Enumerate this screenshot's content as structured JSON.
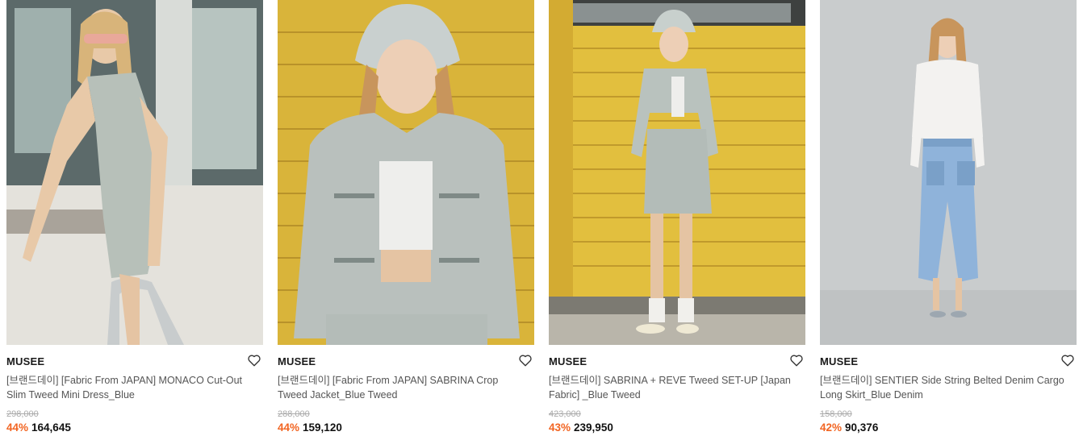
{
  "products": [
    {
      "brand": "MUSEE",
      "name": "[브랜드데이] [Fabric From JAPAN] MONACO Cut-Out Slim Tweed Mini Dress_Blue",
      "original_price": "298,000",
      "discount": "44%",
      "price": "164,645",
      "image": "model-in-tweed-mini-dress-by-pool"
    },
    {
      "brand": "MUSEE",
      "name": "[브랜드데이] [Fabric From JAPAN] SABRINA Crop Tweed Jacket_Blue Tweed",
      "original_price": "288,000",
      "discount": "44%",
      "price": "159,120",
      "image": "model-in-tweed-jacket-and-bucket-hat"
    },
    {
      "brand": "MUSEE",
      "name": "[브랜드데이] SABRINA + REVE Tweed SET-UP [Japan Fabric] _Blue Tweed",
      "original_price": "423,000",
      "discount": "43%",
      "price": "239,950",
      "image": "model-in-tweed-setup-yellow-wall"
    },
    {
      "brand": "MUSEE",
      "name": "[브랜드데이] SENTIER Side String Belted Denim Cargo Long Skirt_Blue Denim",
      "original_price": "158,000",
      "discount": "42%",
      "price": "90,376",
      "image": "model-in-denim-cargo-skirt"
    }
  ],
  "colors": {
    "discount": "#f26522",
    "brand": "#1a1a1a",
    "name": "#555555",
    "original_price": "#aaaaaa"
  }
}
